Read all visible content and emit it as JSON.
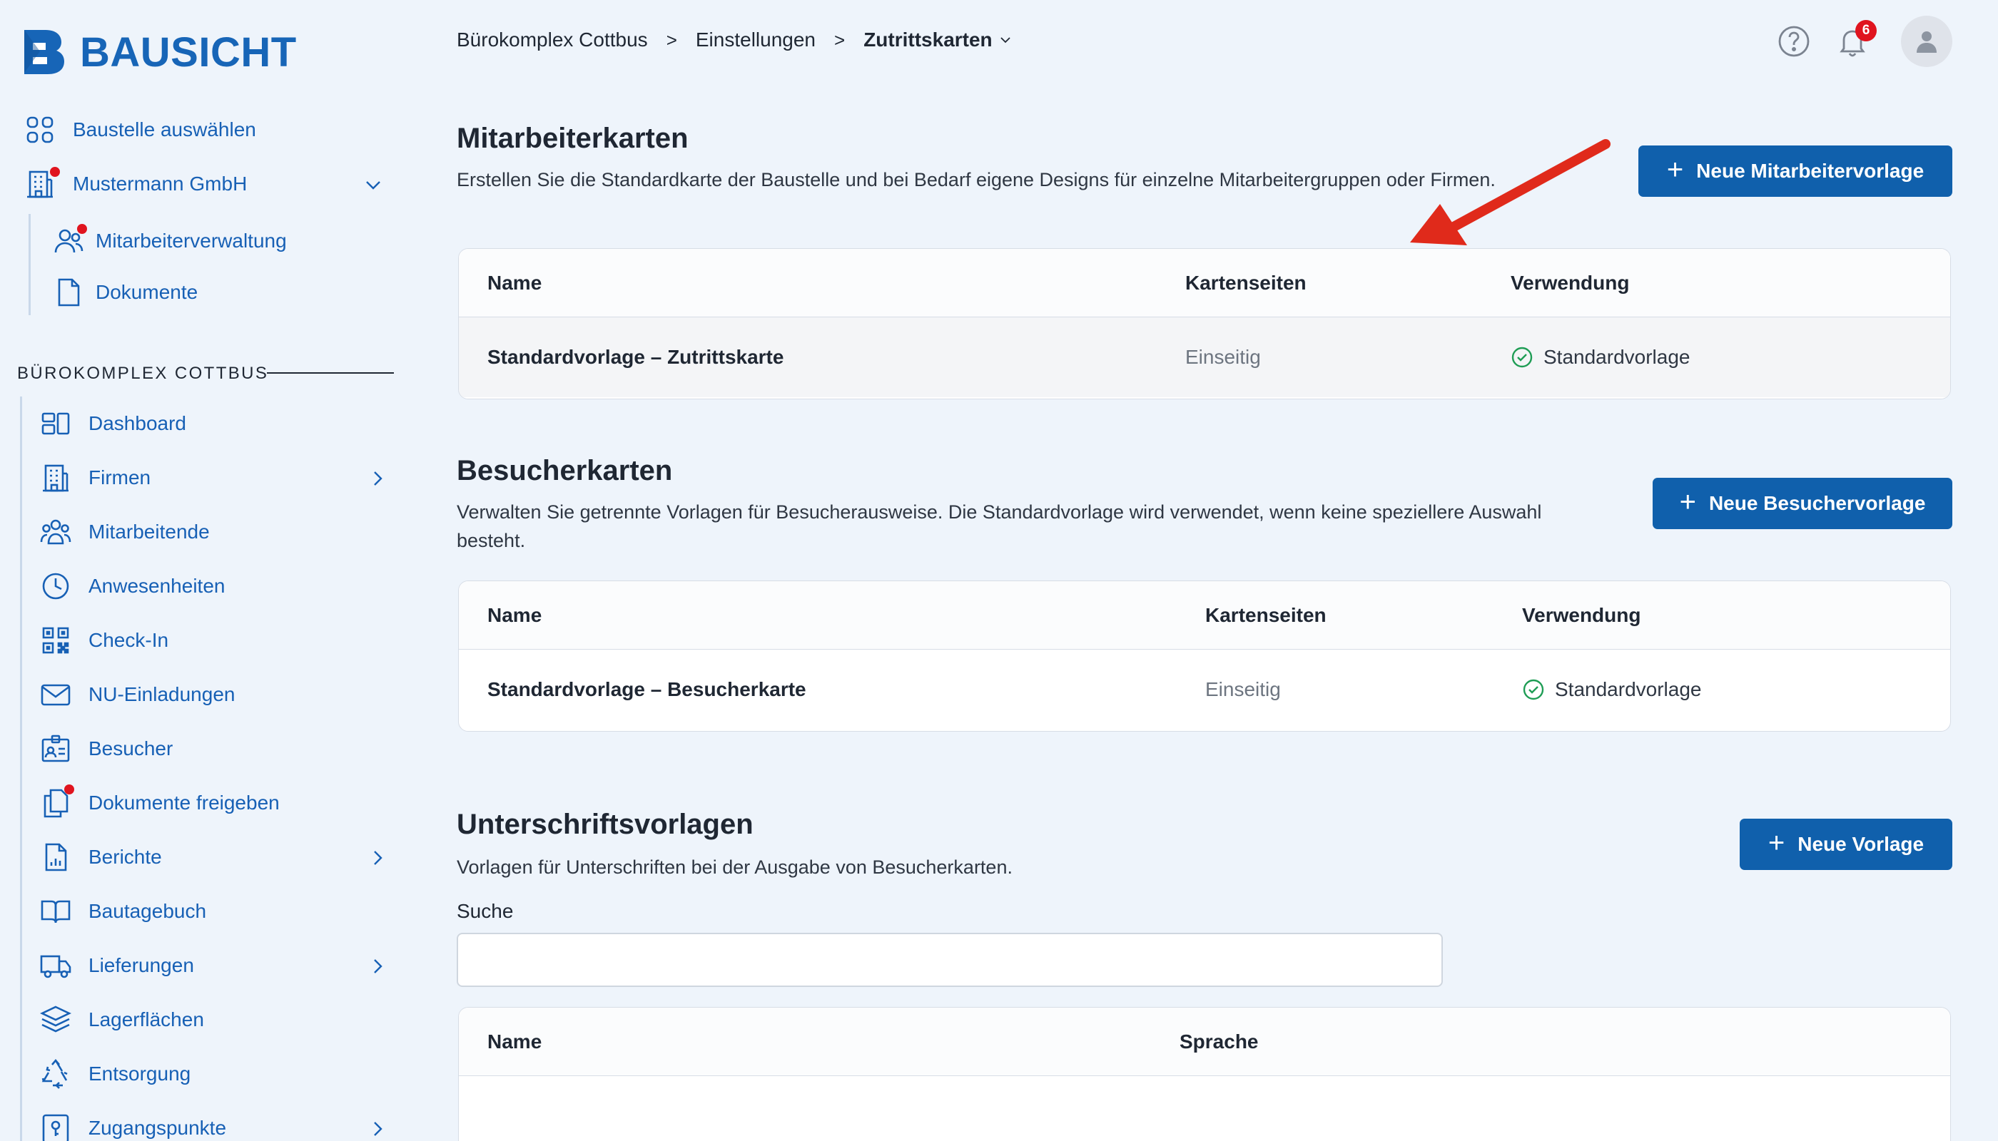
{
  "app": {
    "logo_text": "BAUSICHT"
  },
  "sidebar": {
    "top_items": [
      {
        "label": "Baustelle auswählen",
        "icon": "grid-icon"
      },
      {
        "label": "Mustermann GmbH",
        "icon": "building-icon",
        "badge": true,
        "expanded": true
      },
      {
        "label": "Mitarbeiterverwaltung",
        "icon": "users-icon",
        "badge": true
      },
      {
        "label": "Dokumente",
        "icon": "document-icon"
      }
    ],
    "section_label": "BÜROKOMPLEX COTTBUS",
    "items": [
      {
        "label": "Dashboard",
        "icon": "dashboard-icon"
      },
      {
        "label": "Firmen",
        "icon": "building-icon",
        "has_children": true
      },
      {
        "label": "Mitarbeitende",
        "icon": "people-group-icon"
      },
      {
        "label": "Anwesenheiten",
        "icon": "clock-icon"
      },
      {
        "label": "Check-In",
        "icon": "qr-code-icon"
      },
      {
        "label": "NU-Einladungen",
        "icon": "mail-icon"
      },
      {
        "label": "Besucher",
        "icon": "visitor-badge-icon"
      },
      {
        "label": "Dokumente freigeben",
        "icon": "documents-approve-icon",
        "badge": true
      },
      {
        "label": "Berichte",
        "icon": "report-icon",
        "has_children": true
      },
      {
        "label": "Bautagebuch",
        "icon": "book-icon"
      },
      {
        "label": "Lieferungen",
        "icon": "truck-icon",
        "has_children": true
      },
      {
        "label": "Lagerflächen",
        "icon": "layers-icon"
      },
      {
        "label": "Entsorgung",
        "icon": "recycle-icon"
      },
      {
        "label": "Zugangspunkte",
        "icon": "access-point-icon",
        "has_children": true
      }
    ]
  },
  "breadcrumb": {
    "items": [
      "Bürokomplex Cottbus",
      "Einstellungen",
      "Zutrittskarten"
    ],
    "separator": ">"
  },
  "header": {
    "notifications_count": "6"
  },
  "employee_cards": {
    "title": "Mitarbeiterkarten",
    "description": "Erstellen Sie die Standardkarte der Baustelle und bei Bedarf eigene Designs für einzelne Mitarbeitergruppen oder Firmen.",
    "button_label": "Neue Mitarbeitervorlage",
    "columns": [
      "Name",
      "Kartenseiten",
      "Verwendung"
    ],
    "rows": [
      {
        "name": "Standardvorlage – Zutrittskarte",
        "sides": "Einseitig",
        "usage": "Standardvorlage"
      }
    ]
  },
  "visitor_cards": {
    "title": "Besucherkarten",
    "description": "Verwalten Sie getrennte Vorlagen für Besucherausweise. Die Standardvorlage wird verwendet, wenn keine speziellere Auswahl besteht.",
    "button_label": "Neue Besuchervorlage",
    "columns": [
      "Name",
      "Kartenseiten",
      "Verwendung"
    ],
    "rows": [
      {
        "name": "Standardvorlage – Besucherkarte",
        "sides": "Einseitig",
        "usage": "Standardvorlage"
      }
    ]
  },
  "signature_templates": {
    "title": "Unterschriftsvorlagen",
    "description": "Vorlagen für Unterschriften bei der Ausgabe von Besucherkarten.",
    "button_label": "Neue Vorlage",
    "search_label": "Suche",
    "search_value": "",
    "columns": [
      "Name",
      "Sprache"
    ]
  },
  "colors": {
    "accent": "#1060ac",
    "link": "#1760b5",
    "background": "#eef4fb",
    "badge": "#e0141f",
    "success": "#1f9d55",
    "annotation_arrow": "#e02a1b"
  }
}
